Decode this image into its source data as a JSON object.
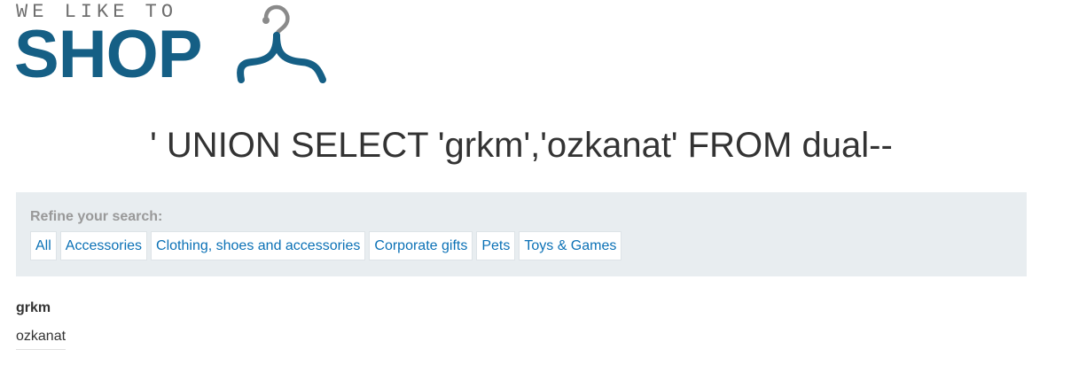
{
  "logo": {
    "tagline": "WE LIKE TO",
    "word": "SHOP",
    "icon": "hanger-icon",
    "brand_color": "#155f85"
  },
  "page_title": "' UNION SELECT 'grkm','ozkanat' FROM dual--",
  "filters": {
    "label": "Refine your search:",
    "items": [
      "All",
      "Accessories",
      "Clothing, shoes and accessories",
      "Corporate gifts",
      "Pets",
      "Toys & Games"
    ],
    "link_color": "#0b71b6",
    "panel_color": "#e8edf0"
  },
  "results": {
    "heading": "grkm",
    "value": "ozkanat"
  }
}
